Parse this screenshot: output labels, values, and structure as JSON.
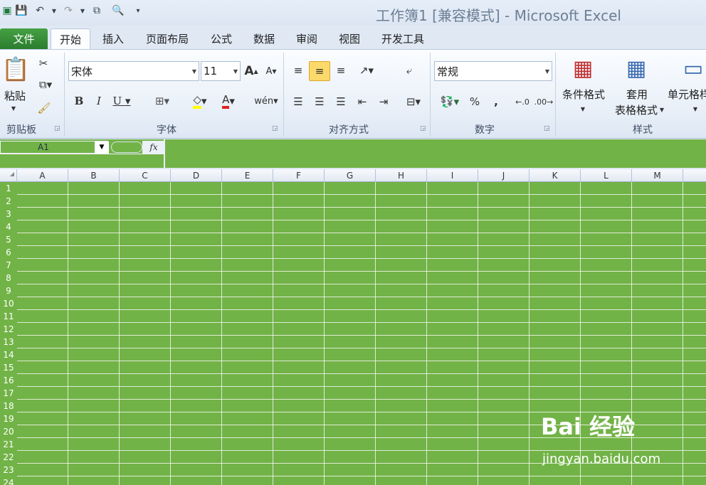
{
  "window": {
    "title": "工作簿1  [兼容模式] - Microsoft Excel"
  },
  "tabs": [
    {
      "label": "文件"
    },
    {
      "label": "开始"
    },
    {
      "label": "插入"
    },
    {
      "label": "页面布局"
    },
    {
      "label": "公式"
    },
    {
      "label": "数据"
    },
    {
      "label": "审阅"
    },
    {
      "label": "视图"
    },
    {
      "label": "开发工具"
    }
  ],
  "ribbon": {
    "clipboard": {
      "group_label": "剪贴板",
      "paste_label": "粘贴"
    },
    "font": {
      "group_label": "字体",
      "font_name": "宋体",
      "font_size": "11"
    },
    "alignment": {
      "group_label": "对齐方式"
    },
    "number": {
      "group_label": "数字",
      "format": "常规"
    },
    "styles": {
      "group_label": "样式",
      "conditional_label": "条件格式",
      "table_label_1": "套用",
      "table_label_2": "表格格式",
      "cell_styles_label": "单元格样"
    }
  },
  "formula_bar": {
    "name_box": "A1",
    "fx": "fx"
  },
  "columns": [
    "A",
    "B",
    "C",
    "D",
    "E",
    "F",
    "G",
    "H",
    "I",
    "J",
    "K",
    "L",
    "M"
  ],
  "rows": [
    "1",
    "2",
    "3",
    "4",
    "5",
    "6",
    "7",
    "8",
    "9",
    "10",
    "11",
    "12",
    "13",
    "14",
    "15",
    "16",
    "17",
    "18",
    "19",
    "20",
    "21",
    "22",
    "23",
    "24"
  ],
  "watermark": {
    "logo": "Bai 经验",
    "url": "jingyan.baidu.com"
  },
  "colors": {
    "sheet_fill": "#72b347",
    "file_tab": "#2b7d2e"
  }
}
